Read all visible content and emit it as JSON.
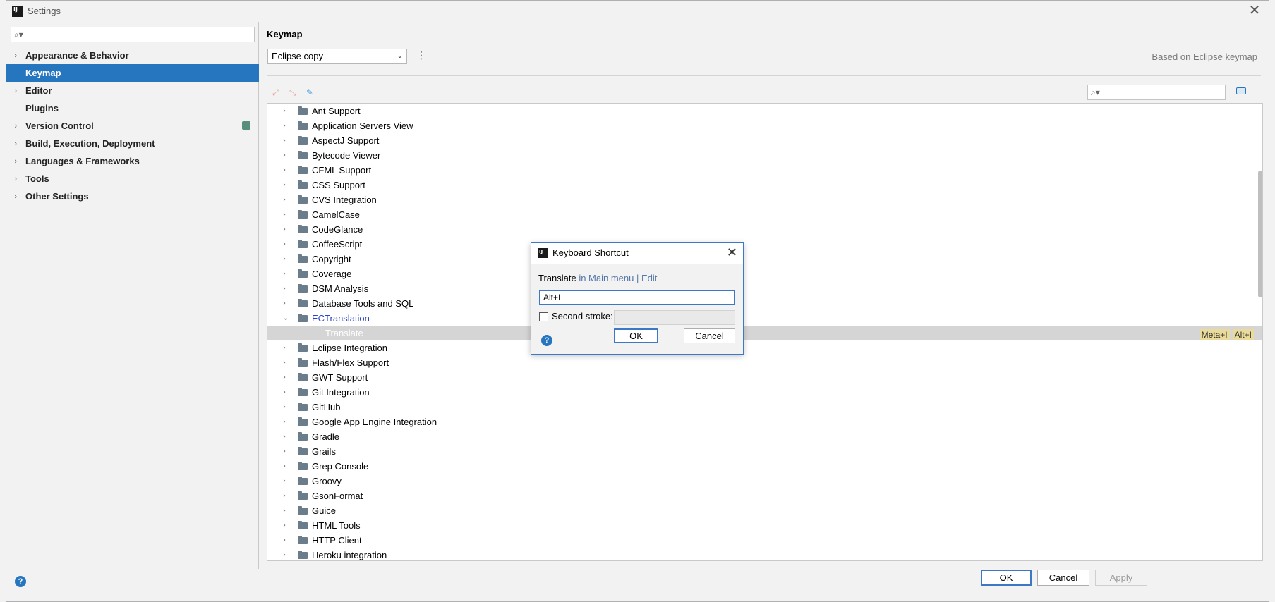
{
  "window": {
    "title": "Settings",
    "close_glyph": "✕"
  },
  "left": {
    "search_placeholder": "",
    "nav": [
      {
        "label": "Appearance & Behavior",
        "chevron": "›",
        "selected": false
      },
      {
        "label": "Keymap",
        "chevron": "",
        "selected": true
      },
      {
        "label": "Editor",
        "chevron": "›",
        "selected": false
      },
      {
        "label": "Plugins",
        "chevron": "",
        "selected": false
      },
      {
        "label": "Version Control",
        "chevron": "›",
        "selected": false,
        "badge": true
      },
      {
        "label": "Build, Execution, Deployment",
        "chevron": "›",
        "selected": false
      },
      {
        "label": "Languages & Frameworks",
        "chevron": "›",
        "selected": false
      },
      {
        "label": "Tools",
        "chevron": "›",
        "selected": false
      },
      {
        "label": "Other Settings",
        "chevron": "›",
        "selected": false
      }
    ],
    "help_glyph": "?"
  },
  "right": {
    "title": "Keymap",
    "keymap_selected": "Eclipse copy",
    "based_on": "Based on Eclipse keymap",
    "search_placeholder": ""
  },
  "tree": {
    "rows": [
      {
        "label": "Ant Support",
        "type": "folder"
      },
      {
        "label": "Application Servers View",
        "type": "folder"
      },
      {
        "label": "AspectJ Support",
        "type": "folder"
      },
      {
        "label": "Bytecode Viewer",
        "type": "folder"
      },
      {
        "label": "CFML Support",
        "type": "folder"
      },
      {
        "label": "CSS Support",
        "type": "folder"
      },
      {
        "label": "CVS Integration",
        "type": "folder"
      },
      {
        "label": "CamelCase",
        "type": "folder"
      },
      {
        "label": "CodeGlance",
        "type": "folder"
      },
      {
        "label": "CoffeeScript",
        "type": "folder"
      },
      {
        "label": "Copyright",
        "type": "folder"
      },
      {
        "label": "Coverage",
        "type": "folder"
      },
      {
        "label": "DSM Analysis",
        "type": "folder"
      },
      {
        "label": "Database Tools and SQL",
        "type": "folder"
      },
      {
        "label": "ECTranslation",
        "type": "expanded"
      },
      {
        "label": "Translate",
        "type": "child",
        "shortcuts": [
          "Meta+I",
          "Alt+I"
        ]
      },
      {
        "label": "Eclipse Integration",
        "type": "folder"
      },
      {
        "label": "Flash/Flex Support",
        "type": "folder"
      },
      {
        "label": "GWT Support",
        "type": "folder"
      },
      {
        "label": "Git Integration",
        "type": "folder"
      },
      {
        "label": "GitHub",
        "type": "folder"
      },
      {
        "label": "Google App Engine Integration",
        "type": "folder"
      },
      {
        "label": "Gradle",
        "type": "folder"
      },
      {
        "label": "Grails",
        "type": "folder"
      },
      {
        "label": "Grep Console",
        "type": "folder"
      },
      {
        "label": "Groovy",
        "type": "folder"
      },
      {
        "label": "GsonFormat",
        "type": "folder"
      },
      {
        "label": "Guice",
        "type": "folder"
      },
      {
        "label": "HTML Tools",
        "type": "folder"
      },
      {
        "label": "HTTP Client",
        "type": "folder"
      },
      {
        "label": "Heroku integration",
        "type": "folder"
      }
    ]
  },
  "buttons": {
    "ok": "OK",
    "cancel": "Cancel",
    "apply": "Apply"
  },
  "dialog": {
    "title": "Keyboard Shortcut",
    "action": "Translate",
    "action_path": " in Main menu | Edit",
    "first_stroke": "Alt+I",
    "second_stroke_label": "Second stroke:",
    "second_stroke_checked": false,
    "ok": "OK",
    "cancel": "Cancel",
    "help_glyph": "?",
    "close_glyph": "✕"
  },
  "colors": {
    "selection": "#2675bf",
    "accent_border": "#3c78c5",
    "shortcut_tag": "#eadb9a",
    "expanded_text": "#2b45c8"
  }
}
